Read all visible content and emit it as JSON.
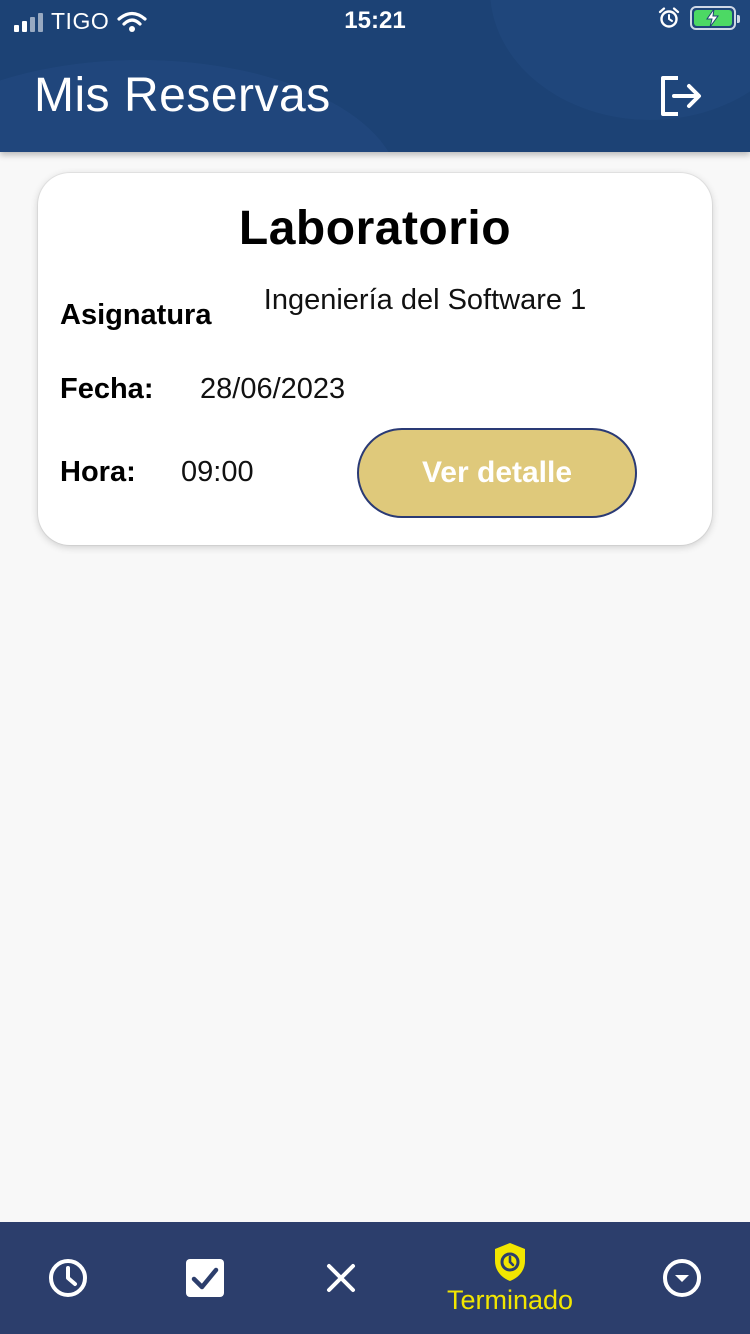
{
  "status_bar": {
    "carrier": "TIGO",
    "time": "15:21",
    "icons": [
      "signal-icon",
      "wifi-icon",
      "alarm-icon",
      "battery-charging-icon"
    ]
  },
  "header": {
    "title": "Mis Reservas",
    "logout_icon": "logout-icon"
  },
  "reservation": {
    "title": "Laboratorio",
    "subject_label": "Asignatura",
    "subject_value": "Ingeniería del Software 1",
    "date_label": "Fecha:",
    "date_value": "28/06/2023",
    "time_label": "Hora:",
    "time_value": "09:00",
    "detail_button": "Ver detalle"
  },
  "bottom_nav": {
    "items": [
      {
        "icon": "clock-icon"
      },
      {
        "icon": "checkbox-checked-icon"
      },
      {
        "icon": "close-icon"
      },
      {
        "icon": "shield-clock-icon",
        "label": "Terminado",
        "active": true
      },
      {
        "icon": "chevron-down-circle-icon"
      }
    ]
  },
  "colors": {
    "header": "#1c4275",
    "nav": "#2c3e6c",
    "active": "#f2e600",
    "button": "#dfc97b",
    "background": "#f8f8f8"
  }
}
